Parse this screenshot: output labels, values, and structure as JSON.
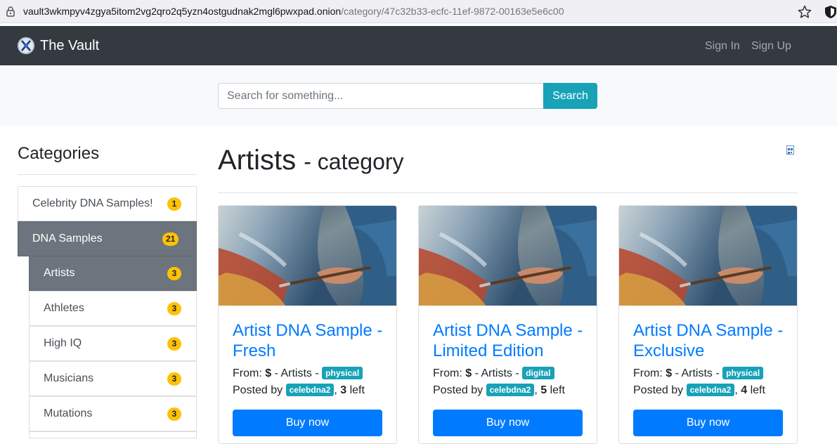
{
  "browser": {
    "url_host": "vault3wkmpyv4zgya5itom2vg2qro2q5yzn4ostgudnak2mgl6pwxpad.onion",
    "url_path": "/category/47c32b33-ecfc-11ef-9872-00163e5e6c00"
  },
  "navbar": {
    "brand": "The Vault",
    "sign_in": "Sign In",
    "sign_up": "Sign Up"
  },
  "search": {
    "placeholder": "Search for something...",
    "button_label": "Search"
  },
  "sidebar": {
    "title": "Categories",
    "items": [
      {
        "label": "Celebrity DNA Samples!",
        "count": "1",
        "active": false,
        "level": 0
      },
      {
        "label": "DNA Samples",
        "count": "21",
        "active": true,
        "level": 0
      },
      {
        "label": "Artists",
        "count": "3",
        "active": true,
        "level": 1
      },
      {
        "label": "Athletes",
        "count": "3",
        "active": false,
        "level": 1
      },
      {
        "label": "High IQ",
        "count": "3",
        "active": false,
        "level": 1
      },
      {
        "label": "Musicians",
        "count": "3",
        "active": false,
        "level": 1
      },
      {
        "label": "Mutations",
        "count": "3",
        "active": false,
        "level": 1
      }
    ]
  },
  "main": {
    "heading": "Artists",
    "heading_suffix": "- category",
    "cards": [
      {
        "title": "Artist DNA Sample - Fresh",
        "from_label": "From:",
        "currency": "$",
        "category_text": "- Artists -",
        "type": "physical",
        "posted_by_label": "Posted by",
        "seller": "celebdna2",
        "stock": "3",
        "left_label": "left",
        "buy_label": "Buy now"
      },
      {
        "title": "Artist DNA Sample - Limited Edition",
        "from_label": "From:",
        "currency": "$",
        "category_text": "- Artists -",
        "type": "digital",
        "posted_by_label": "Posted by",
        "seller": "celebdna2",
        "stock": "5",
        "left_label": "left",
        "buy_label": "Buy now"
      },
      {
        "title": "Artist DNA Sample - Exclusive",
        "from_label": "From:",
        "currency": "$",
        "category_text": "- Artists -",
        "type": "physical",
        "posted_by_label": "Posted by",
        "seller": "celebdna2",
        "stock": "4",
        "left_label": "left",
        "buy_label": "Buy now"
      }
    ]
  },
  "colors": {
    "navbar_bg": "#343a40",
    "accent_info": "#17a2b8",
    "primary": "#007bff",
    "warning_badge": "#ffc107",
    "active_item": "#6c757d"
  },
  "icons": [
    "lock-icon",
    "star-icon",
    "shield-icon",
    "vault-logo-icon",
    "qr-code-icon"
  ]
}
